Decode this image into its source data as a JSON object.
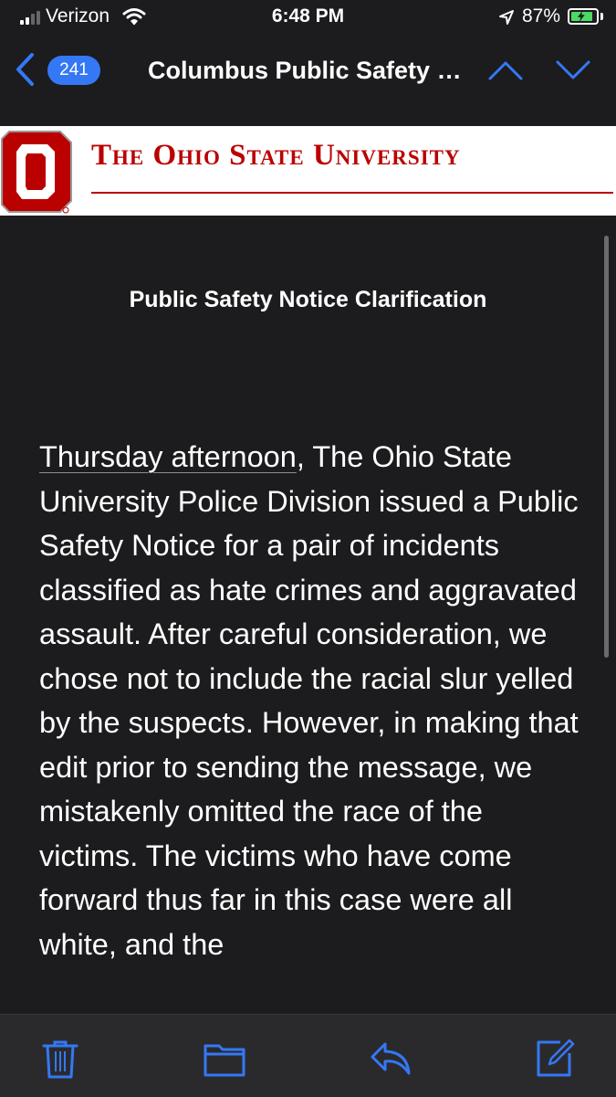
{
  "status_bar": {
    "carrier": "Verizon",
    "time": "6:48 PM",
    "battery_percent": "87%",
    "battery_level": 0.87,
    "charging": true,
    "icons": [
      "signal-icon",
      "wifi-icon",
      "location-arrow-icon",
      "battery-icon"
    ]
  },
  "nav": {
    "unread_count": "241",
    "title": "Columbus Public Safety Notice Clarification",
    "icons": [
      "back-chevron-icon",
      "previous-message-icon",
      "next-message-icon"
    ]
  },
  "banner": {
    "university_name": "The Ohio State University",
    "logo": "block-o-logo"
  },
  "email": {
    "heading": "Public Safety Notice Clarification",
    "link_text": "Thursday afternoon",
    "body": ", The Ohio State University Police Division issued a Public Safety Notice for a pair of incidents classified as hate crimes and aggravated assault. After careful consideration, we chose not to include the racial slur yelled by the suspects. However, in making that edit prior to sending the message, we mistakenly omitted the race of the victims. The victims who have come forward thus far in this case were all white, and the"
  },
  "toolbar": {
    "icons": [
      "trash-icon",
      "folder-icon",
      "reply-icon",
      "compose-icon"
    ]
  },
  "colors": {
    "background": "#1c1c1e",
    "accent": "#3478f6",
    "scarlet": "#bb0000",
    "battery_green": "#4cd964"
  }
}
